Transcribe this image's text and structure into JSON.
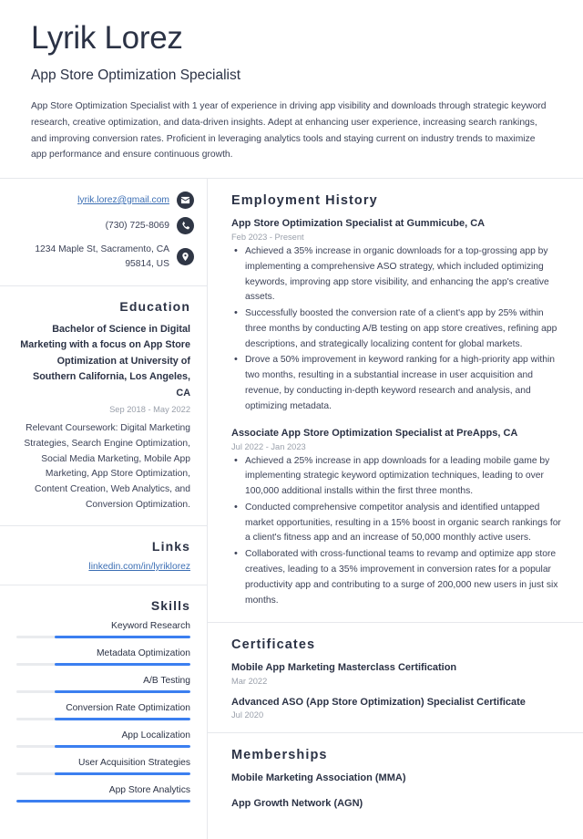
{
  "header": {
    "full_name": "Lyrik Lorez",
    "job_title": "App Store Optimization Specialist",
    "summary": "App Store Optimization Specialist with 1 year of experience in driving app visibility and downloads through strategic keyword research, creative optimization, and data-driven insights. Adept at enhancing user experience, increasing search rankings, and improving conversion rates. Proficient in leveraging analytics tools and staying current on industry trends to maximize app performance and ensure continuous growth."
  },
  "colors": {
    "accent_blue": "#3b7ff0",
    "link_blue": "#3b6eb4",
    "heading_navy": "#2b3245",
    "body_text": "#3c4257",
    "muted": "#9aa0ab",
    "divider": "#e6e8ec",
    "icon_circle": "#2f3645"
  },
  "contact": {
    "items": [
      {
        "icon": "envelope-icon",
        "text": "lyrik.lorez@gmail.com",
        "is_link": true
      },
      {
        "icon": "phone-icon",
        "text": "(730) 725-8069",
        "is_link": false
      },
      {
        "icon": "location-pin-icon",
        "text": "1234 Maple St, Sacramento, CA 95814, US",
        "is_link": false
      }
    ]
  },
  "education": {
    "heading": "Education",
    "degree": "Bachelor of Science in Digital Marketing with a focus on App Store Optimization at University of Southern California, Los Angeles, CA",
    "dates": "Sep 2018 - May 2022",
    "description": "Relevant Coursework: Digital Marketing Strategies, Search Engine Optimization, Social Media Marketing, Mobile App Marketing, App Store Optimization, Content Creation, Web Analytics, and Conversion Optimization."
  },
  "links": {
    "heading": "Links",
    "items": [
      {
        "label": "linkedin.com/in/lyriklorez"
      }
    ]
  },
  "skills": {
    "heading": "Skills",
    "items": [
      {
        "name": "Keyword Research",
        "level": 78
      },
      {
        "name": "Metadata Optimization",
        "level": 78
      },
      {
        "name": "A/B Testing",
        "level": 78
      },
      {
        "name": "Conversion Rate Optimization",
        "level": 78
      },
      {
        "name": "App Localization",
        "level": 78
      },
      {
        "name": "User Acquisition Strategies",
        "level": 78
      },
      {
        "name": "App Store Analytics",
        "level": 100
      }
    ]
  },
  "employment": {
    "heading": "Employment History",
    "entries": [
      {
        "title": "App Store Optimization Specialist at Gummicube, CA",
        "dates": "Feb 2023 - Present",
        "bullets": [
          "Achieved a 35% increase in organic downloads for a top-grossing app by implementing a comprehensive ASO strategy, which included optimizing keywords, improving app store visibility, and enhancing the app's creative assets.",
          "Successfully boosted the conversion rate of a client's app by 25% within three months by conducting A/B testing on app store creatives, refining app descriptions, and strategically localizing content for global markets.",
          "Drove a 50% improvement in keyword ranking for a high-priority app within two months, resulting in a substantial increase in user acquisition and revenue, by conducting in-depth keyword research and analysis, and optimizing metadata."
        ]
      },
      {
        "title": "Associate App Store Optimization Specialist at PreApps, CA",
        "dates": "Jul 2022 - Jan 2023",
        "bullets": [
          "Achieved a 25% increase in app downloads for a leading mobile game by implementing strategic keyword optimization techniques, leading to over 100,000 additional installs within the first three months.",
          "Conducted comprehensive competitor analysis and identified untapped market opportunities, resulting in a 15% boost in organic search rankings for a client's fitness app and an increase of 50,000 monthly active users.",
          "Collaborated with cross-functional teams to revamp and optimize app store creatives, leading to a 35% improvement in conversion rates for a popular productivity app and contributing to a surge of 200,000 new users in just six months."
        ]
      }
    ]
  },
  "certificates": {
    "heading": "Certificates",
    "entries": [
      {
        "name": "Mobile App Marketing Masterclass Certification",
        "date": "Mar 2022"
      },
      {
        "name": "Advanced ASO (App Store Optimization) Specialist Certificate",
        "date": "Jul 2020"
      }
    ]
  },
  "memberships": {
    "heading": "Memberships",
    "entries": [
      {
        "name": "Mobile Marketing Association (MMA)"
      },
      {
        "name": "App Growth Network (AGN)"
      }
    ]
  }
}
